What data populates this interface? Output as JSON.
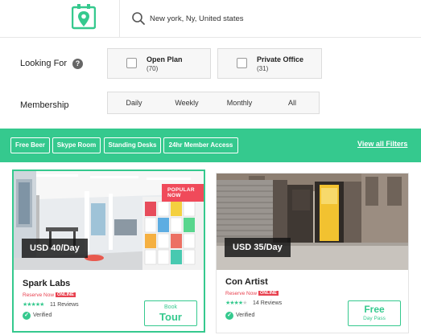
{
  "header": {
    "search_value": "New york, Ny, United states"
  },
  "filters": {
    "looking_for_label": "Looking For",
    "help_icon": "?",
    "options": [
      {
        "title": "Open Plan",
        "count": "(70)",
        "checked": false
      },
      {
        "title": "Private Office",
        "count": "(31)",
        "checked": false
      }
    ],
    "membership_label": "Membership",
    "membership_options": [
      "Daily",
      "Weekly",
      "Monthly",
      "All"
    ]
  },
  "amenities": {
    "tags": [
      "Free Beer",
      "Skype Room",
      "Standing Desks",
      "24hr Member Access"
    ],
    "view_all": "View all Filters"
  },
  "listings": [
    {
      "name": "Spark Labs",
      "price": "USD 40/Day",
      "ribbon": "POPULAR NOW",
      "reserve_text": "Reserve Now",
      "online_badge": "ONLINE",
      "rating": 5,
      "reviews": "11 Reviews",
      "verified": "Verified",
      "cta_top": "Book",
      "cta_main": "Tour"
    },
    {
      "name": "Con Artist",
      "price": "USD 35/Day",
      "reserve_text": "Reserve Now",
      "online_badge": "ONLINE",
      "rating": 4,
      "reviews": "14 Reviews",
      "verified": "Verified",
      "cta_main": "Free",
      "cta_bottom": "Day Pass"
    }
  ],
  "colors": {
    "accent": "#35c98e",
    "alert": "#e8414f"
  }
}
